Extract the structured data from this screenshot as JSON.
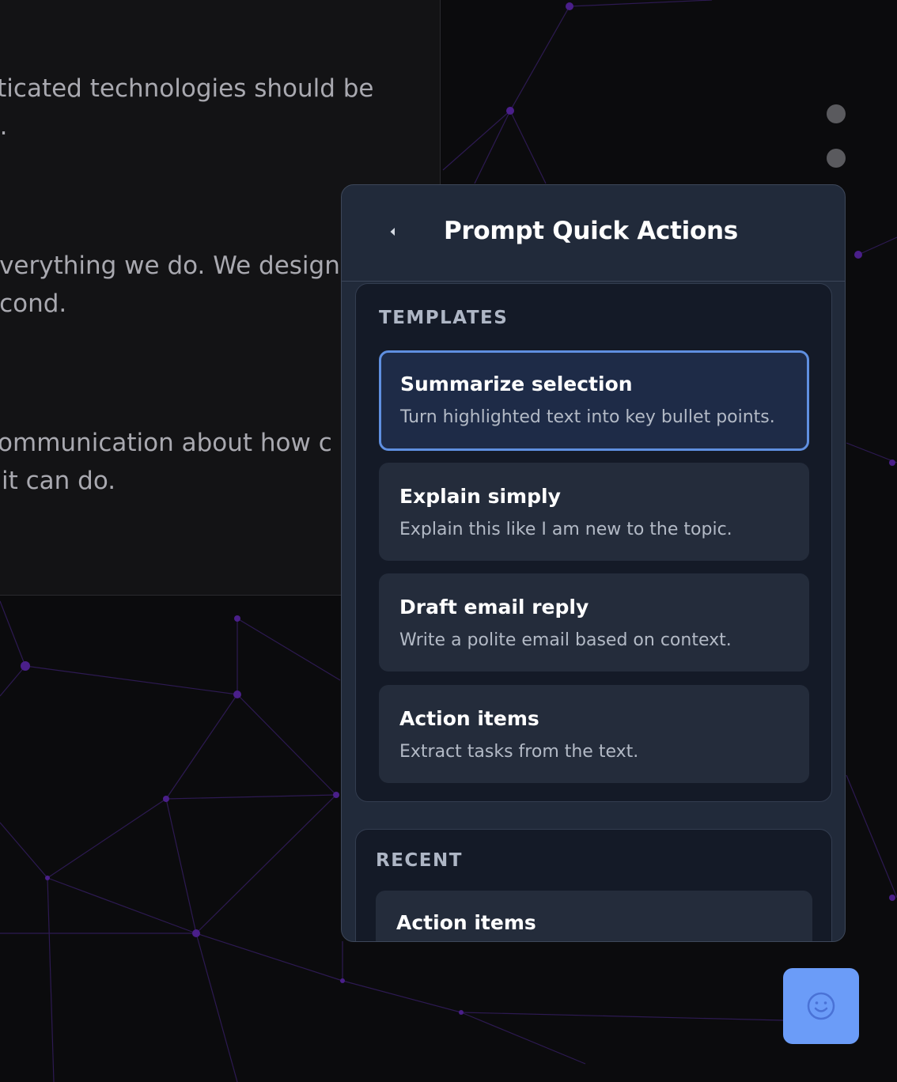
{
  "background": {
    "paragraphs": [
      [
        "sticated technologies should be",
        "d."
      ],
      [
        "everything we do. We design",
        "econd."
      ],
      [
        " communication about how c",
        "t it can do."
      ]
    ]
  },
  "panel": {
    "title": "Prompt Quick Actions",
    "back_icon": "chevron-left-icon",
    "templates": {
      "label": "TEMPLATES",
      "items": [
        {
          "title": "Summarize selection",
          "description": "Turn highlighted text into key bullet points.",
          "selected": true
        },
        {
          "title": "Explain simply",
          "description": "Explain this like I am new to the topic."
        },
        {
          "title": "Draft email reply",
          "description": "Write a polite email based on context."
        },
        {
          "title": "Action items",
          "description": "Extract tasks from the text."
        }
      ]
    },
    "recent": {
      "label": "RECENT",
      "items": [
        {
          "title": "Action items"
        }
      ]
    }
  },
  "fab_icon": "smile-face-icon",
  "colors": {
    "accent": "#6b9cf8",
    "selected_border": "#5f8fe0",
    "panel_bg": "#212a3a",
    "section_bg": "#141a27"
  }
}
